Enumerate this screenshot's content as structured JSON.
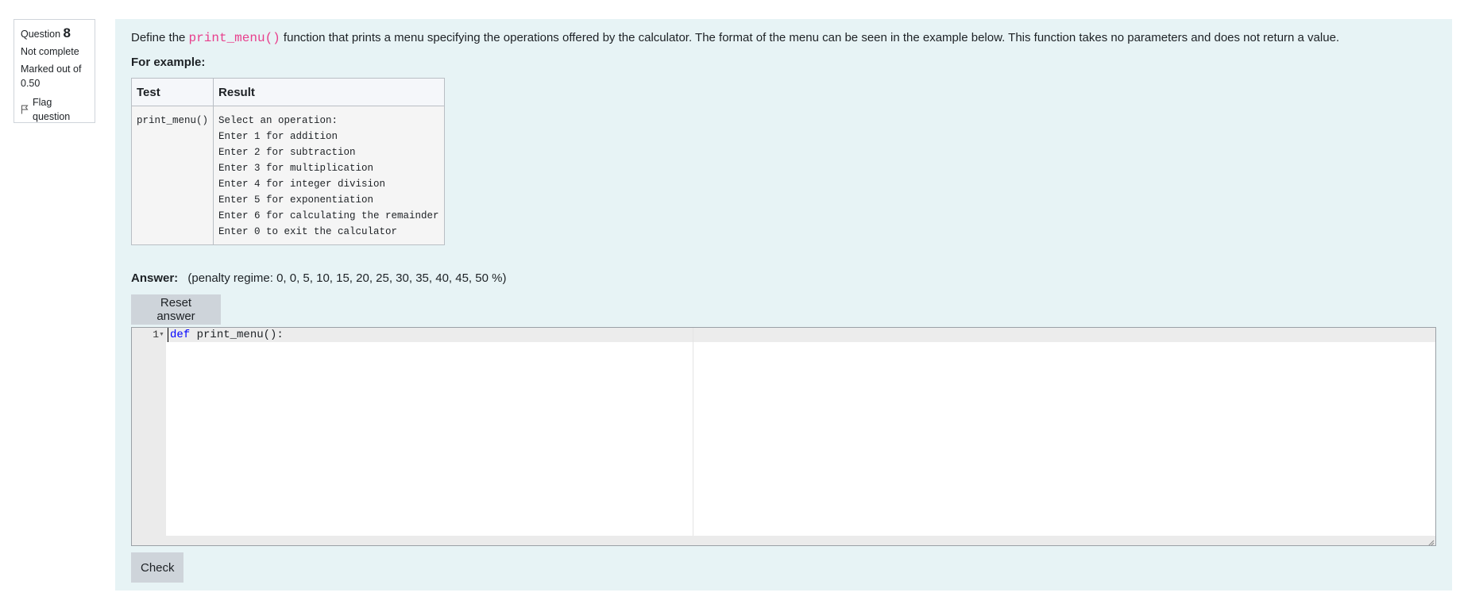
{
  "info": {
    "question_label": "Question",
    "question_number": "8",
    "state": "Not complete",
    "grade_line1": "Marked out of",
    "grade_line2": "0.50",
    "flag_label": "Flag question"
  },
  "question": {
    "text_before": "Define the ",
    "function_code": "print_menu()",
    "text_after": " function that prints a menu specifying the operations offered by the calculator. The format of the menu can be seen in the example below. This function takes no parameters and does not return a value.",
    "for_example_label": "For example:",
    "table": {
      "headers": [
        "Test",
        "Result"
      ],
      "test": "print_menu()",
      "result_lines": [
        "Select an operation:",
        "Enter 1 for addition",
        "Enter 2 for subtraction",
        "Enter 3 for multiplication",
        "Enter 4 for integer division",
        "Enter 5 for exponentiation",
        "Enter 6 for calculating the remainder",
        "Enter 0 to exit the calculator"
      ]
    }
  },
  "answer": {
    "label": "Answer:",
    "penalty": "(penalty regime: 0, 0, 5, 10, 15, 20, 25, 30, 35, 40, 45, 50 %)",
    "reset_label": "Reset answer",
    "check_label": "Check"
  },
  "editor": {
    "line_number": "1",
    "keyword": "def",
    "code_rest": " print_menu():"
  },
  "icons": {
    "flag": "flag-icon",
    "fold": "fold-arrow-icon",
    "resize": "resize-handle-icon"
  },
  "colors": {
    "content_background": "#e7f3f5",
    "inline_code": "#e83e8c",
    "keyword": "#0000ff",
    "button": "#ced4da"
  }
}
